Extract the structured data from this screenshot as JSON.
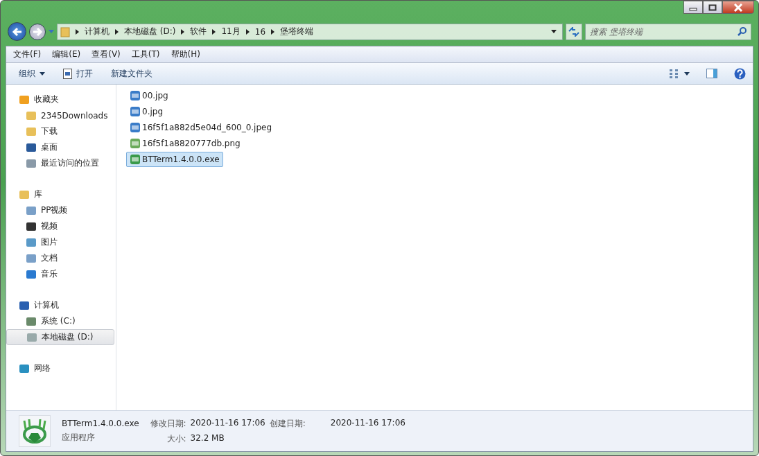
{
  "address": {
    "breadcrumbs": [
      "计算机",
      "本地磁盘 (D:)",
      "软件",
      "11月",
      "16",
      "堡塔终端"
    ]
  },
  "search": {
    "placeholder": "搜索 堡塔终端"
  },
  "menu": [
    "文件(F)",
    "编辑(E)",
    "查看(V)",
    "工具(T)",
    "帮助(H)"
  ],
  "toolbar": [
    {
      "label": "组织",
      "kind": "dropdown"
    },
    {
      "label": "打开",
      "kind": "open"
    },
    {
      "label": "新建文件夹",
      "kind": "plain"
    }
  ],
  "sidebar": [
    {
      "label": "收藏夹",
      "kind": "star",
      "selected": false,
      "children": [
        {
          "label": "2345Downloads",
          "kind": "folder",
          "selected": false
        },
        {
          "label": "下载",
          "kind": "download",
          "selected": false
        },
        {
          "label": "桌面",
          "kind": "desktop",
          "selected": false
        },
        {
          "label": "最近访问的位置",
          "kind": "recent",
          "selected": false
        }
      ]
    },
    {
      "label": "库",
      "kind": "library",
      "selected": false,
      "children": [
        {
          "label": "PP视频",
          "kind": "document",
          "selected": false
        },
        {
          "label": "视频",
          "kind": "film",
          "selected": false
        },
        {
          "label": "图片",
          "kind": "picture",
          "selected": false
        },
        {
          "label": "文档",
          "kind": "document",
          "selected": false
        },
        {
          "label": "音乐",
          "kind": "music",
          "selected": false
        }
      ]
    },
    {
      "label": "计算机",
      "kind": "computer",
      "selected": false,
      "children": [
        {
          "label": "系统 (C:)",
          "kind": "system-drive",
          "selected": false
        },
        {
          "label": "本地磁盘 (D:)",
          "kind": "drive",
          "selected": true
        }
      ]
    },
    {
      "label": "网络",
      "kind": "network",
      "selected": false
    }
  ],
  "files": [
    {
      "name": "00.jpg",
      "kind": "jpg",
      "selected": false
    },
    {
      "name": "0.jpg",
      "kind": "jpg",
      "selected": false
    },
    {
      "name": "16f5f1a882d5e04d_600_0.jpeg",
      "kind": "jpg",
      "selected": false
    },
    {
      "name": "16f5f1a8820777db.png",
      "kind": "png",
      "selected": false
    },
    {
      "name": "BTTerm1.4.0.0.exe",
      "kind": "exe",
      "selected": true
    }
  ],
  "details": {
    "name": "BTTerm1.4.0.0.exe",
    "type": "应用程序",
    "fields": [
      {
        "label": "修改日期:",
        "value": "2020-11-16 17:06"
      },
      {
        "label": "大小:",
        "value": "32.2 MB"
      },
      {
        "label": "创建日期:",
        "value": "2020-11-16 17:06"
      }
    ]
  }
}
